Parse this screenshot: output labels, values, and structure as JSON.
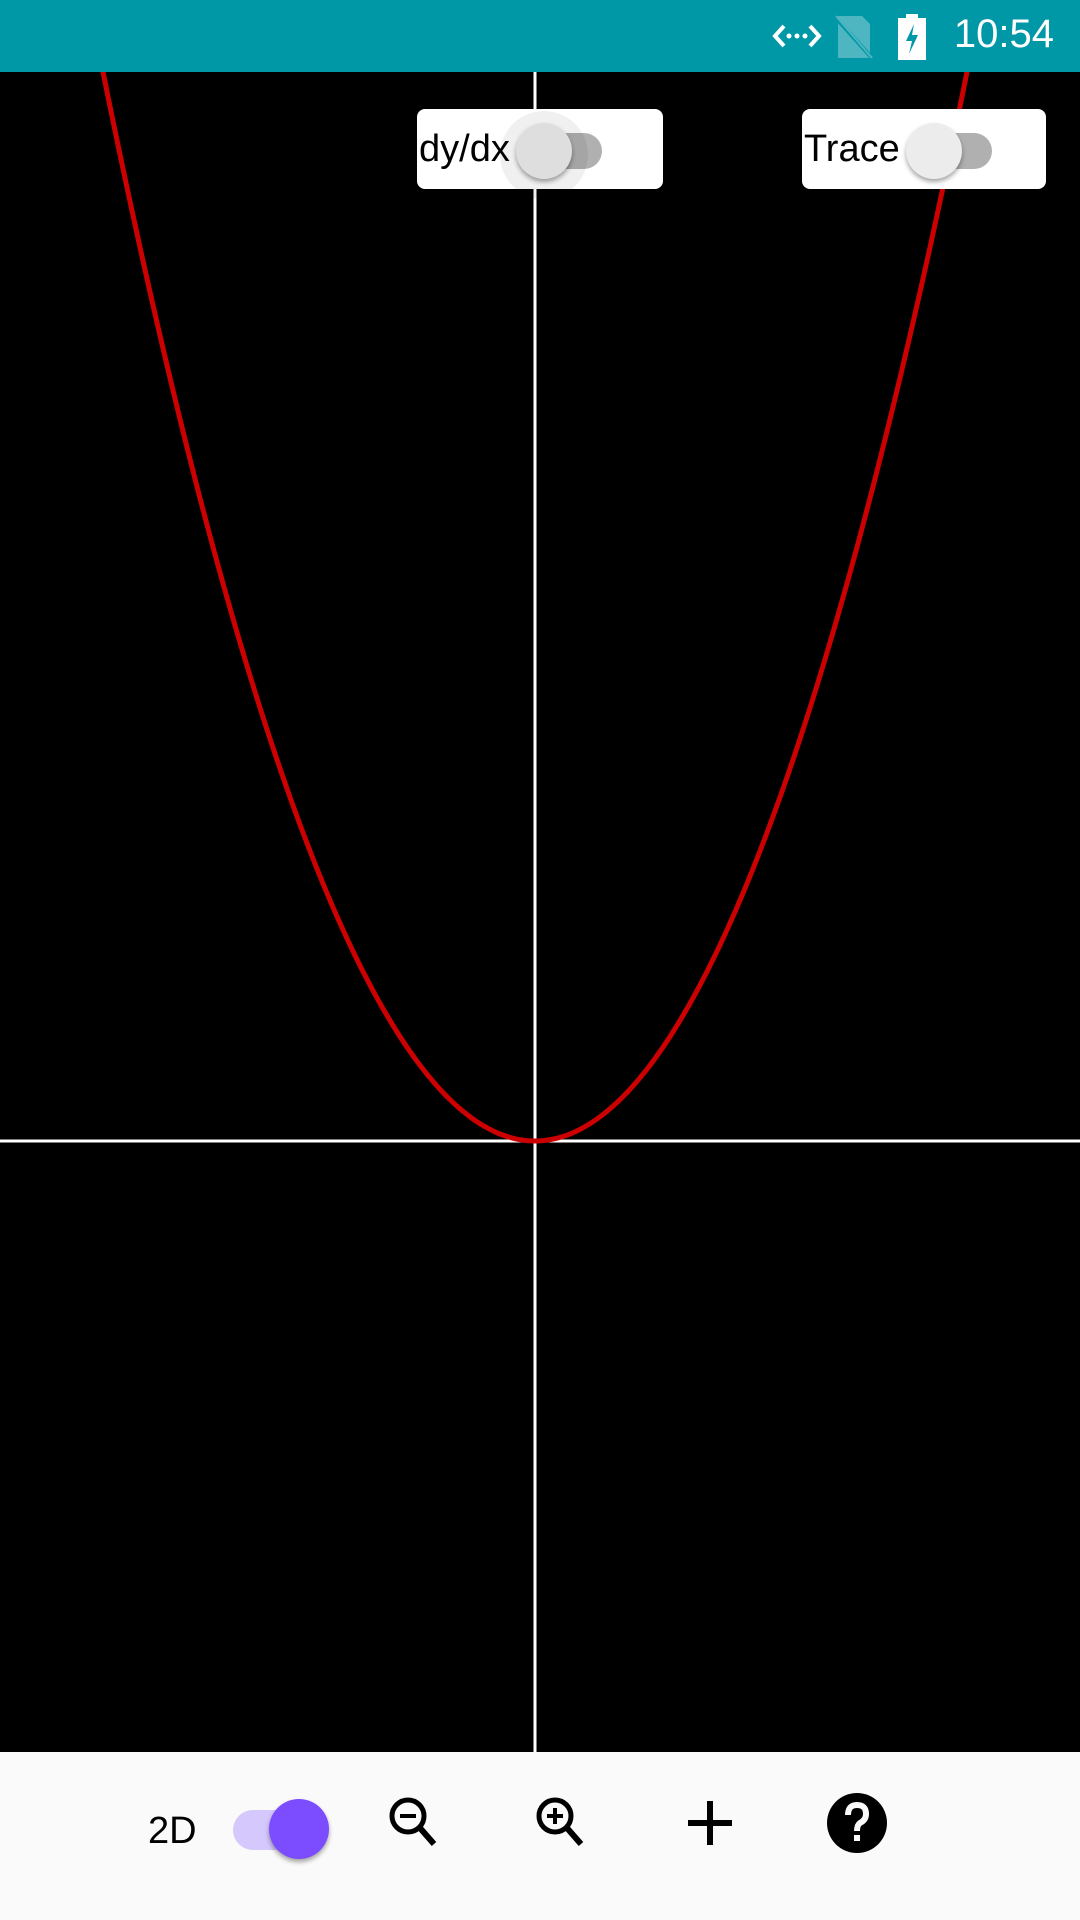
{
  "status_bar": {
    "time": "10:54",
    "icons": [
      "code-arrows-icon",
      "no-sim-icon",
      "battery-charging-icon"
    ],
    "color": "#0098a6"
  },
  "graph": {
    "background": "#000000",
    "axis_color": "#ffffff",
    "curve_color": "#cc0000"
  },
  "toggles": {
    "derivative": {
      "label": "dy/dx",
      "on": false
    },
    "trace": {
      "label": "Trace",
      "on": false
    }
  },
  "bottom_bar": {
    "mode_label": "2D",
    "mode_toggle_on": true,
    "accent": "#7c4dff",
    "buttons": [
      "zoom-out-icon",
      "zoom-in-icon",
      "add-icon",
      "help-icon"
    ]
  }
}
